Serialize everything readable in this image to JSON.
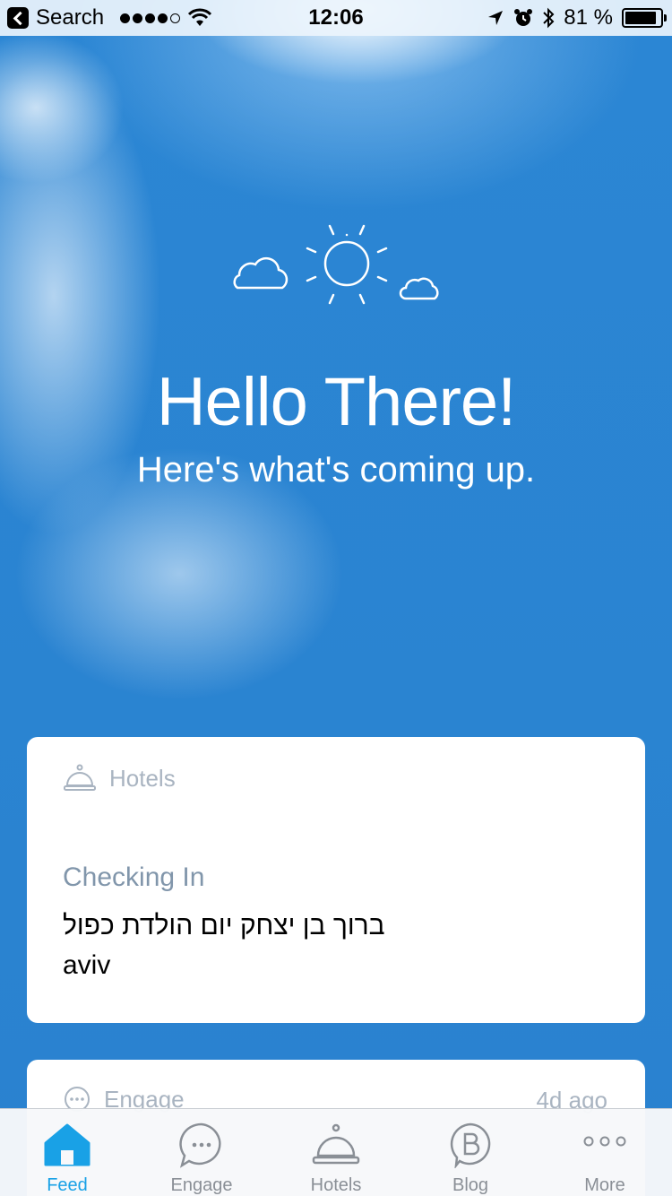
{
  "status_bar": {
    "back_label": "Search",
    "time": "12:06",
    "battery": "81 %"
  },
  "hero": {
    "title": "Hello There!",
    "subtitle": "Here's what's coming up."
  },
  "cards": [
    {
      "header": "Hotels",
      "title": "Checking In",
      "lines": [
        "ברוך בן יצחק יום הולדת כפול",
        "aviv"
      ]
    },
    {
      "header": "Engage",
      "time": "4d ago"
    }
  ],
  "tabs": [
    {
      "label": "Feed",
      "icon": "home-icon",
      "active": true
    },
    {
      "label": "Engage",
      "icon": "chat-bubble-icon",
      "active": false
    },
    {
      "label": "Hotels",
      "icon": "bell-icon",
      "active": false
    },
    {
      "label": "Blog",
      "icon": "blog-b-icon",
      "active": false
    },
    {
      "label": "More",
      "icon": "more-dots-icon",
      "active": false
    }
  ],
  "colors": {
    "sky": "#2a83d1",
    "tab_active": "#19a1e6",
    "tab_inactive": "#8a8f96",
    "card_muted": "#a9b4c1"
  }
}
